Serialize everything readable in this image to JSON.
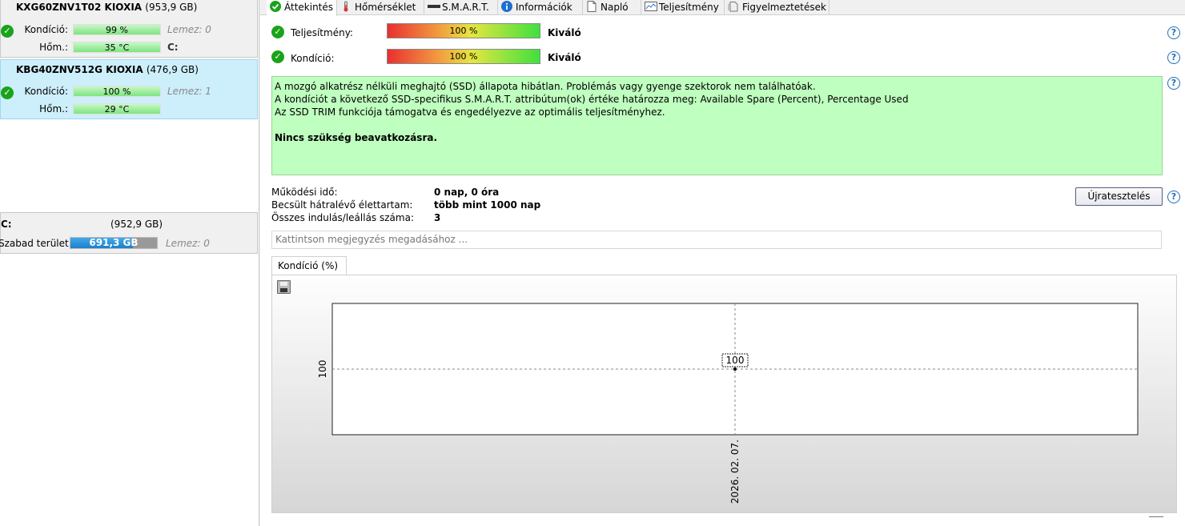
{
  "disks": [
    {
      "model": "KXG60ZNV1T02 KIOXIA",
      "size": "(953,9 GB)",
      "health_label": "Kondíció:",
      "health_value": "99 %",
      "temp_label": "Hőm.:",
      "temp_value": "35 °C",
      "disk_index": "Lemez: 0",
      "drive_letter": "C:"
    },
    {
      "model": "KBG40ZNV512G KIOXIA",
      "size": "(476,9 GB)",
      "health_label": "Kondíció:",
      "health_value": "100 %",
      "temp_label": "Hőm.:",
      "temp_value": "29 °C",
      "disk_index": "Lemez: 1"
    }
  ],
  "volume": {
    "letter": "C:",
    "size": "(952,9 GB)",
    "free_label": "Szabad terület",
    "free_value": "691,3 GB",
    "free_fraction": 0.725,
    "disk_index": "Lemez: 0"
  },
  "tabs": [
    {
      "label": "Áttekintés",
      "icon": "check-icon",
      "active": true
    },
    {
      "label": "Hőmérséklet",
      "icon": "thermometer-icon"
    },
    {
      "label": "S.M.A.R.T.",
      "icon": "drive-icon"
    },
    {
      "label": "Információk",
      "icon": "info-icon"
    },
    {
      "label": "Napló",
      "icon": "document-icon"
    },
    {
      "label": "Teljesítmény",
      "icon": "chart-icon"
    },
    {
      "label": "Figyelmeztetések",
      "icon": "alerts-icon"
    }
  ],
  "performance": {
    "label": "Teljesítmény:",
    "value": "100 %",
    "rating": "Kiváló"
  },
  "health": {
    "label": "Kondíció:",
    "value": "100 %",
    "rating": "Kiváló"
  },
  "info_lines": [
    "A mozgó alkatrész nélküli meghajtó (SSD) állapota hibátlan. Problémás vagy gyenge szektorok nem találhatóak.",
    "A kondíciót a következő SSD-specifikus S.M.A.R.T. attribútum(ok) értéke határozza meg:  Available Spare (Percent), Percentage Used",
    "Az SSD TRIM funkciója támogatva és engedélyezve az optimális teljesítményhez."
  ],
  "info_conclusion": "Nincs szükség beavatkozásra.",
  "stats": [
    {
      "label": "Működési idő:",
      "value": "0 nap, 0 óra"
    },
    {
      "label": "Becsült hátralévő élettartam:",
      "value": "több mint 1000 nap"
    },
    {
      "label": "Összes indulás/leállás száma:",
      "value": "3"
    }
  ],
  "retest_label": "Újratesztelés",
  "note_placeholder": "Kattintson megjegyzés megadásához ...",
  "chart_tab_label": "Kondíció  (%)",
  "chart_data": {
    "type": "line",
    "x": [
      "2026. 02. 07."
    ],
    "series": [
      {
        "values": [
          100
        ]
      }
    ],
    "yticks": [
      "100"
    ],
    "data_labels": [
      "100"
    ],
    "grid": true
  }
}
